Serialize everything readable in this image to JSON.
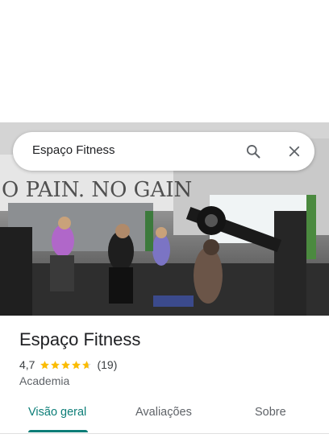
{
  "search": {
    "query": "Espaço Fitness"
  },
  "hero": {
    "wall_text": "O PAIN. NO GAIN"
  },
  "place": {
    "name": "Espaço Fitness",
    "rating": "4,7",
    "stars_value": 4.7,
    "review_count": "(19)",
    "category": "Academia"
  },
  "tabs": [
    {
      "label": "Visão geral",
      "active": true
    },
    {
      "label": "Avaliações",
      "active": false
    },
    {
      "label": "Sobre",
      "active": false
    }
  ],
  "colors": {
    "accent": "#0b7d77",
    "star": "#fbbc04",
    "star_empty": "#dadce0"
  },
  "icons": {
    "search": "search-icon",
    "close": "close-icon",
    "star": "star-icon"
  }
}
